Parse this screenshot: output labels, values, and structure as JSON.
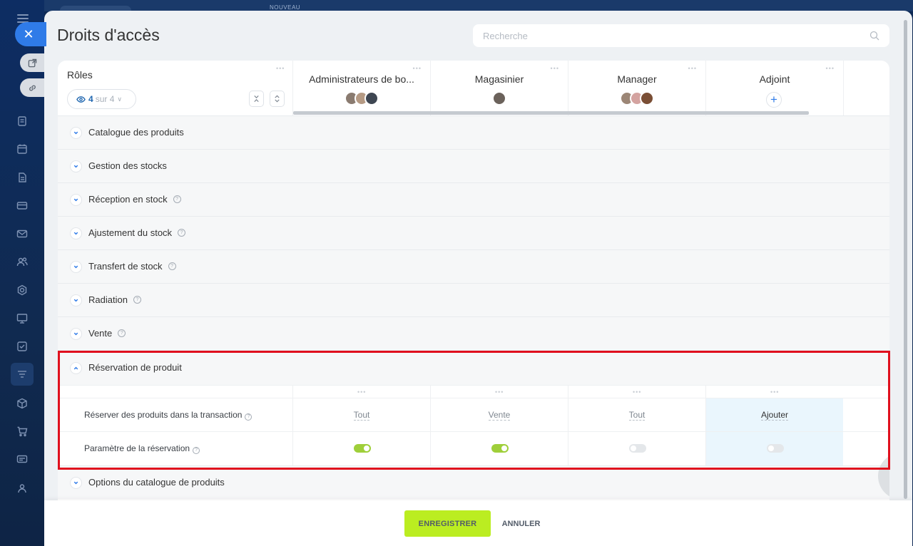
{
  "background": {
    "top_label": "NOUVEAU"
  },
  "nav": {
    "icons": [
      "hamburger-icon",
      "close-icon",
      "external-link-icon",
      "link-icon",
      "document-icon",
      "calendar-icon",
      "file-icon",
      "card-icon",
      "mail-icon",
      "users-icon",
      "hexagon-icon",
      "presentation-icon",
      "checkbox-icon",
      "filter-icon",
      "box-icon",
      "cart-icon",
      "chat-icon",
      "group-icon"
    ]
  },
  "page": {
    "title": "Droits d'accès",
    "search_placeholder": "Recherche"
  },
  "header": {
    "roles_label": "Rôles",
    "visible_count": "4",
    "of_total": "sur 4",
    "roles": [
      {
        "name": "Administrateurs de bo...",
        "avatars": [
          "#8a7b70",
          "#b59a84",
          "#3e4652"
        ]
      },
      {
        "name": "Magasinier",
        "avatars": [
          "#6b625b"
        ]
      },
      {
        "name": "Manager",
        "avatars": [
          "#9c8676",
          "#d4a3a0",
          "#7a4e35"
        ]
      },
      {
        "name": "Adjoint",
        "avatars": []
      }
    ]
  },
  "sections": [
    {
      "label": "Catalogue des produits",
      "help": false,
      "expanded": false
    },
    {
      "label": "Gestion des stocks",
      "help": false,
      "expanded": false
    },
    {
      "label": "Réception en stock",
      "help": true,
      "expanded": false
    },
    {
      "label": "Ajustement du stock",
      "help": true,
      "expanded": false
    },
    {
      "label": "Transfert de stock",
      "help": true,
      "expanded": false
    },
    {
      "label": "Radiation",
      "help": true,
      "expanded": false
    },
    {
      "label": "Vente",
      "help": true,
      "expanded": false
    },
    {
      "label": "Réservation de produit",
      "help": false,
      "expanded": true
    },
    {
      "label": "Options du catalogue de produits",
      "help": false,
      "expanded": false
    }
  ],
  "reservation_rows": [
    {
      "label": "Réserver des produits dans la transaction",
      "values": [
        "Tout",
        "Vente",
        "Tout",
        "Ajouter"
      ]
    },
    {
      "label": "Paramètre de la réservation",
      "switches": [
        true,
        true,
        false,
        false
      ]
    }
  ],
  "footer": {
    "save": "ENREGISTRER",
    "cancel": "ANNULER"
  },
  "colors": {
    "accent": "#2f7be8",
    "save_button": "#bbed21",
    "switch_on": "#9fcf3a",
    "highlight_box": "#e0101e"
  }
}
